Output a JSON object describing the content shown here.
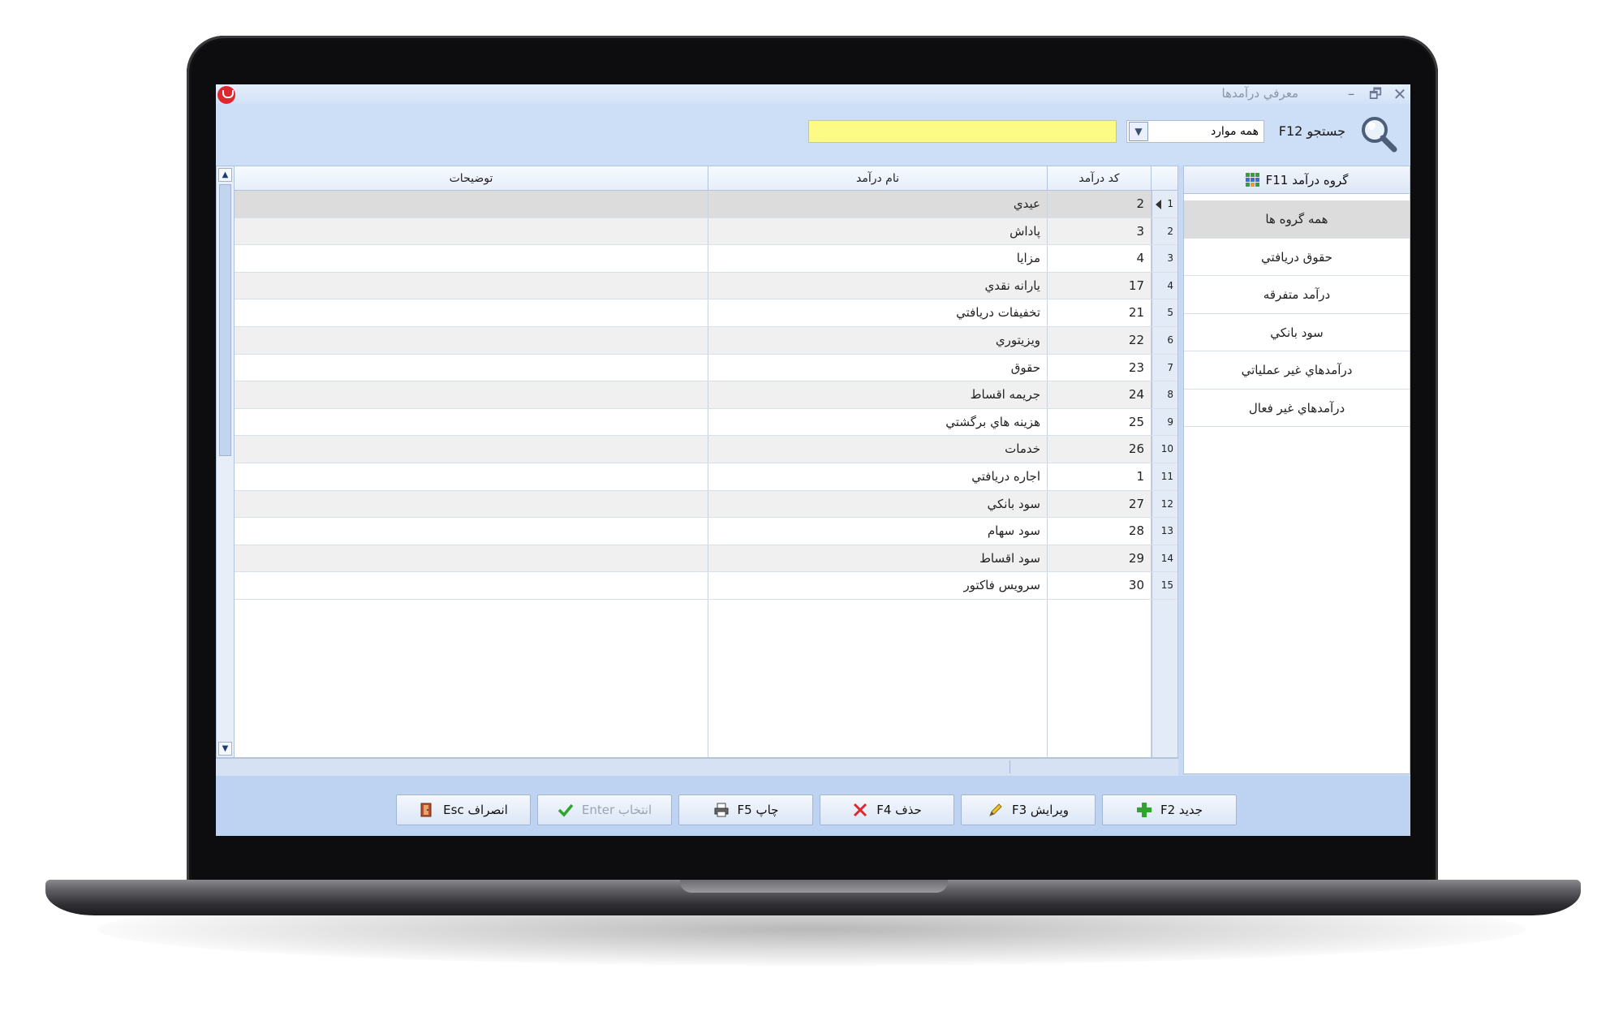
{
  "window": {
    "title": "معرفي درآمدها",
    "minimize": "–",
    "restore": "🗗",
    "close": "✕"
  },
  "toolbar": {
    "search_label": "جستجو F12",
    "filter_value": "همه موارد",
    "search_value": "",
    "search_placeholder": ""
  },
  "grid": {
    "columns": [
      "توضيحات",
      "نام درآمد",
      "کد درآمد"
    ],
    "rows": [
      {
        "idx": "1",
        "code": "2",
        "name": "عيدي",
        "desc": ""
      },
      {
        "idx": "2",
        "code": "3",
        "name": "پاداش",
        "desc": ""
      },
      {
        "idx": "3",
        "code": "4",
        "name": "مزايا",
        "desc": ""
      },
      {
        "idx": "4",
        "code": "17",
        "name": "يارانه نقدي",
        "desc": ""
      },
      {
        "idx": "5",
        "code": "21",
        "name": "تخفيفات دريافتي",
        "desc": ""
      },
      {
        "idx": "6",
        "code": "22",
        "name": "ويزيتوري",
        "desc": ""
      },
      {
        "idx": "7",
        "code": "23",
        "name": "حقوق",
        "desc": ""
      },
      {
        "idx": "8",
        "code": "24",
        "name": "جريمه اقساط",
        "desc": ""
      },
      {
        "idx": "9",
        "code": "25",
        "name": "هزينه هاي برگشتي",
        "desc": ""
      },
      {
        "idx": "10",
        "code": "26",
        "name": "خدمات",
        "desc": ""
      },
      {
        "idx": "11",
        "code": "1",
        "name": "اجاره دريافتي",
        "desc": ""
      },
      {
        "idx": "12",
        "code": "27",
        "name": "سود بانکي",
        "desc": ""
      },
      {
        "idx": "13",
        "code": "28",
        "name": "سود سهام",
        "desc": ""
      },
      {
        "idx": "14",
        "code": "29",
        "name": "سود اقساط",
        "desc": ""
      },
      {
        "idx": "15",
        "code": "30",
        "name": "سرويس فاکتور",
        "desc": ""
      }
    ]
  },
  "side": {
    "header": "گروه درآمد F11",
    "items": [
      "همه گروه ها",
      "حقوق دريافتي",
      "درآمد متفرقه",
      "سود بانکي",
      "درآمدهاي غير عملياتي",
      "درآمدهاي غير فعال"
    ]
  },
  "buttons": {
    "new": "جديد F2",
    "edit": "ويرايش F3",
    "delete": "حذف F4",
    "print": "چاپ F5",
    "select": "انتخاب Enter",
    "cancel": "انصراف Esc"
  },
  "colors": {
    "accent": "#cddff6",
    "search_bg": "#fbfb86",
    "selected_row": "#dcdcdc",
    "new_icon": "#2fa52f",
    "delete_icon": "#e0272e"
  }
}
